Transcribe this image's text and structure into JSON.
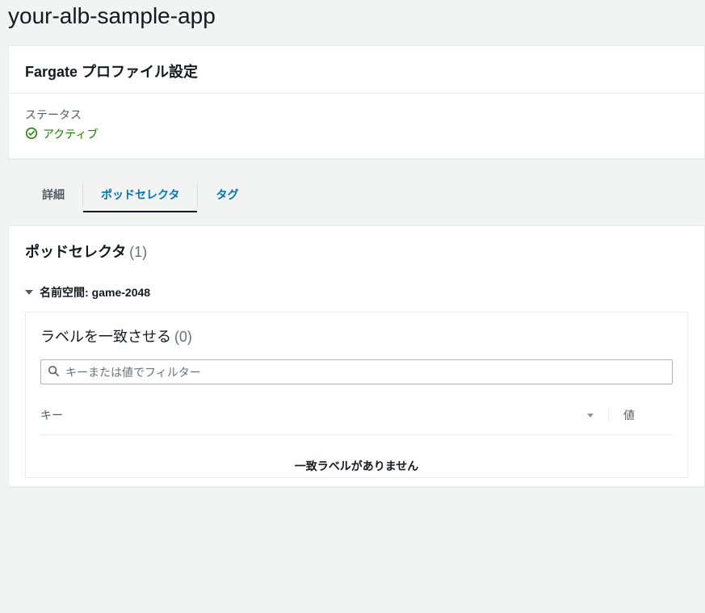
{
  "page": {
    "title": "your-alb-sample-app"
  },
  "config_panel": {
    "heading": "Fargate プロファイル設定",
    "status_label": "ステータス",
    "status_value": "アクティブ"
  },
  "tabs": {
    "detail": "詳細",
    "pod_selector": "ポッドセレクタ",
    "tags": "タグ"
  },
  "selector_panel": {
    "title": "ポッドセレクタ",
    "count": "(1)",
    "namespace_prefix": "名前空間:",
    "namespace_value": "game-2048",
    "match_labels_title": "ラベルを一致させる",
    "match_labels_count": "(0)",
    "filter_placeholder": "キーまたは値でフィルター",
    "col_key": "キー",
    "col_value": "値",
    "empty_message": "一致ラベルがありません"
  }
}
